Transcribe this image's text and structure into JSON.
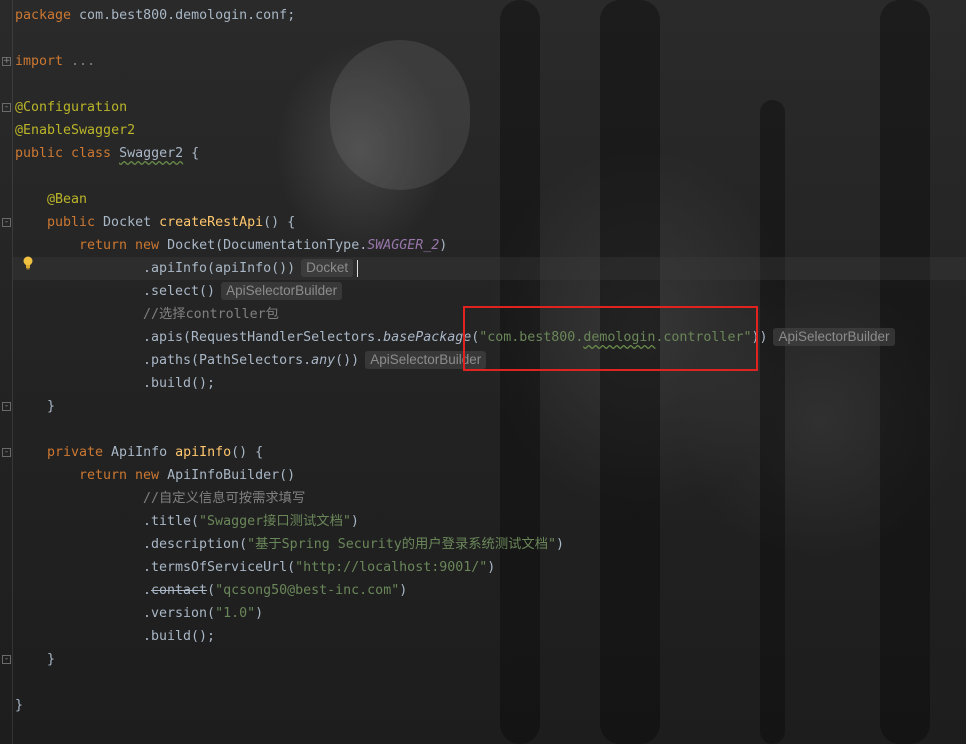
{
  "code": {
    "l1": {
      "kw": "package",
      "rest": " com.best800.demologin.conf;"
    },
    "l3": {
      "kw": "import",
      "rest": " ..."
    },
    "l5": {
      "ann": "@Configuration"
    },
    "l6": {
      "ann": "@EnableSwagger2"
    },
    "l7": {
      "kw": "public class",
      "cls": "Swagger2",
      "brace": "{"
    },
    "l9": {
      "ann": "@Bean"
    },
    "l10": {
      "kw": "public",
      "type": " Docket ",
      "fn": "createRestApi",
      "rest": "() {"
    },
    "l11": {
      "kw1": "return new",
      "type": " Docket(DocumentationType.",
      "static": "SWAGGER_2",
      "rest": ")"
    },
    "l12": {
      "code": ".apiInfo(apiInfo())",
      "hint": "Docket"
    },
    "l13": {
      "code": ".select()",
      "hint": "ApiSelectorBuilder"
    },
    "l14": {
      "cmt": "//选择controller包"
    },
    "l15": {
      "pre": ".apis(RequestHandlerSelectors.",
      "method": "basePackage",
      "open": "(",
      "str_a": "\"com.best800.",
      "str_b": "demologin",
      "str_c": ".controller\"",
      "close": "))",
      "hint": "ApiSelectorBuilder"
    },
    "l16": {
      "pre": ".paths(PathSelectors.",
      "method": "any",
      "rest": "())",
      "hint": "ApiSelectorBuilder"
    },
    "l17": {
      "code": ".build();"
    },
    "l18": {
      "code": "}"
    },
    "l20": {
      "kw": "private",
      "type": " ApiInfo ",
      "fn": "apiInfo",
      "rest": "() {"
    },
    "l21": {
      "kw": "return new",
      "rest": " ApiInfoBuilder()"
    },
    "l22": {
      "cmt": "//自定义信息可按需求填写"
    },
    "l23": {
      "pre": ".title(",
      "str": "\"Swagger接口测试文档\"",
      "post": ")"
    },
    "l24": {
      "pre": ".description(",
      "str": "\"基于Spring Security的用户登录系统测试文档\"",
      "post": ")"
    },
    "l25": {
      "pre": ".termsOfServiceUrl(",
      "str": "\"http://localhost:9001/\"",
      "post": ")"
    },
    "l26": {
      "dot": ".",
      "strike": "contact",
      "pre": "(",
      "str": "\"qcsong50@best-inc.com\"",
      "post": ")"
    },
    "l27": {
      "pre": ".version(",
      "str": "\"1.0\"",
      "post": ")"
    },
    "l28": {
      "code": ".build();"
    },
    "l29": {
      "code": "}"
    },
    "l31": {
      "code": "}"
    }
  },
  "icons": {
    "intention": "lightbulb-icon",
    "fold": "fold-marker-icon"
  },
  "colors": {
    "keyword": "#cc7832",
    "annotation": "#bbb529",
    "function": "#ffc66d",
    "string": "#6a8759",
    "comment": "#808080",
    "static_field": "#9876aa",
    "default_text": "#a9b7c6",
    "highlight_box": "#e0231f"
  }
}
